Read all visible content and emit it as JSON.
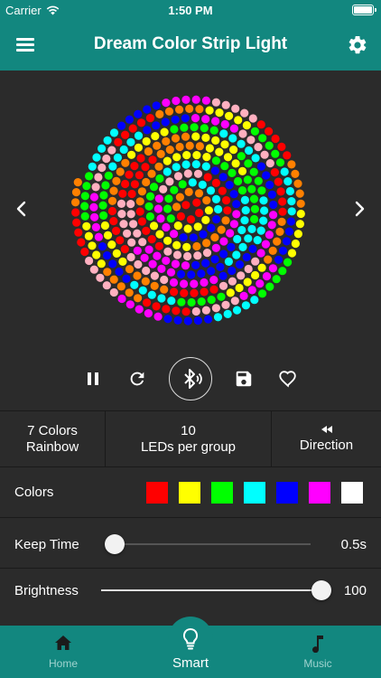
{
  "status": {
    "carrier": "Carrier",
    "time": "1:50 PM"
  },
  "header": {
    "title": "Dream Color Strip Light"
  },
  "settings": {
    "colors_count": "7 Colors",
    "mode": "Rainbow",
    "group_value": "10",
    "group_label": "LEDs per group",
    "direction_label": "Direction"
  },
  "colors": {
    "label": "Colors",
    "swatches": [
      "#ff0000",
      "#ffff00",
      "#00ff00",
      "#00ffff",
      "#0000ff",
      "#ff00ff",
      "#ffffff"
    ]
  },
  "keep_time": {
    "label": "Keep Time",
    "value": "0.5s",
    "level": 0.04
  },
  "brightness": {
    "label": "Brightness",
    "value": "100",
    "level": 1.0
  },
  "tabs": [
    {
      "label": "Home",
      "icon": "home-icon"
    },
    {
      "label": "Smart",
      "icon": "lightbulb-icon"
    },
    {
      "label": "Music",
      "icon": "music-note-icon"
    }
  ],
  "accent_color": "#12877f",
  "spiral_palette": [
    "#ff0000",
    "#ff8000",
    "#ffff00",
    "#00ff00",
    "#00ffff",
    "#0000ff",
    "#ff00ff",
    "#ffb0c0"
  ]
}
